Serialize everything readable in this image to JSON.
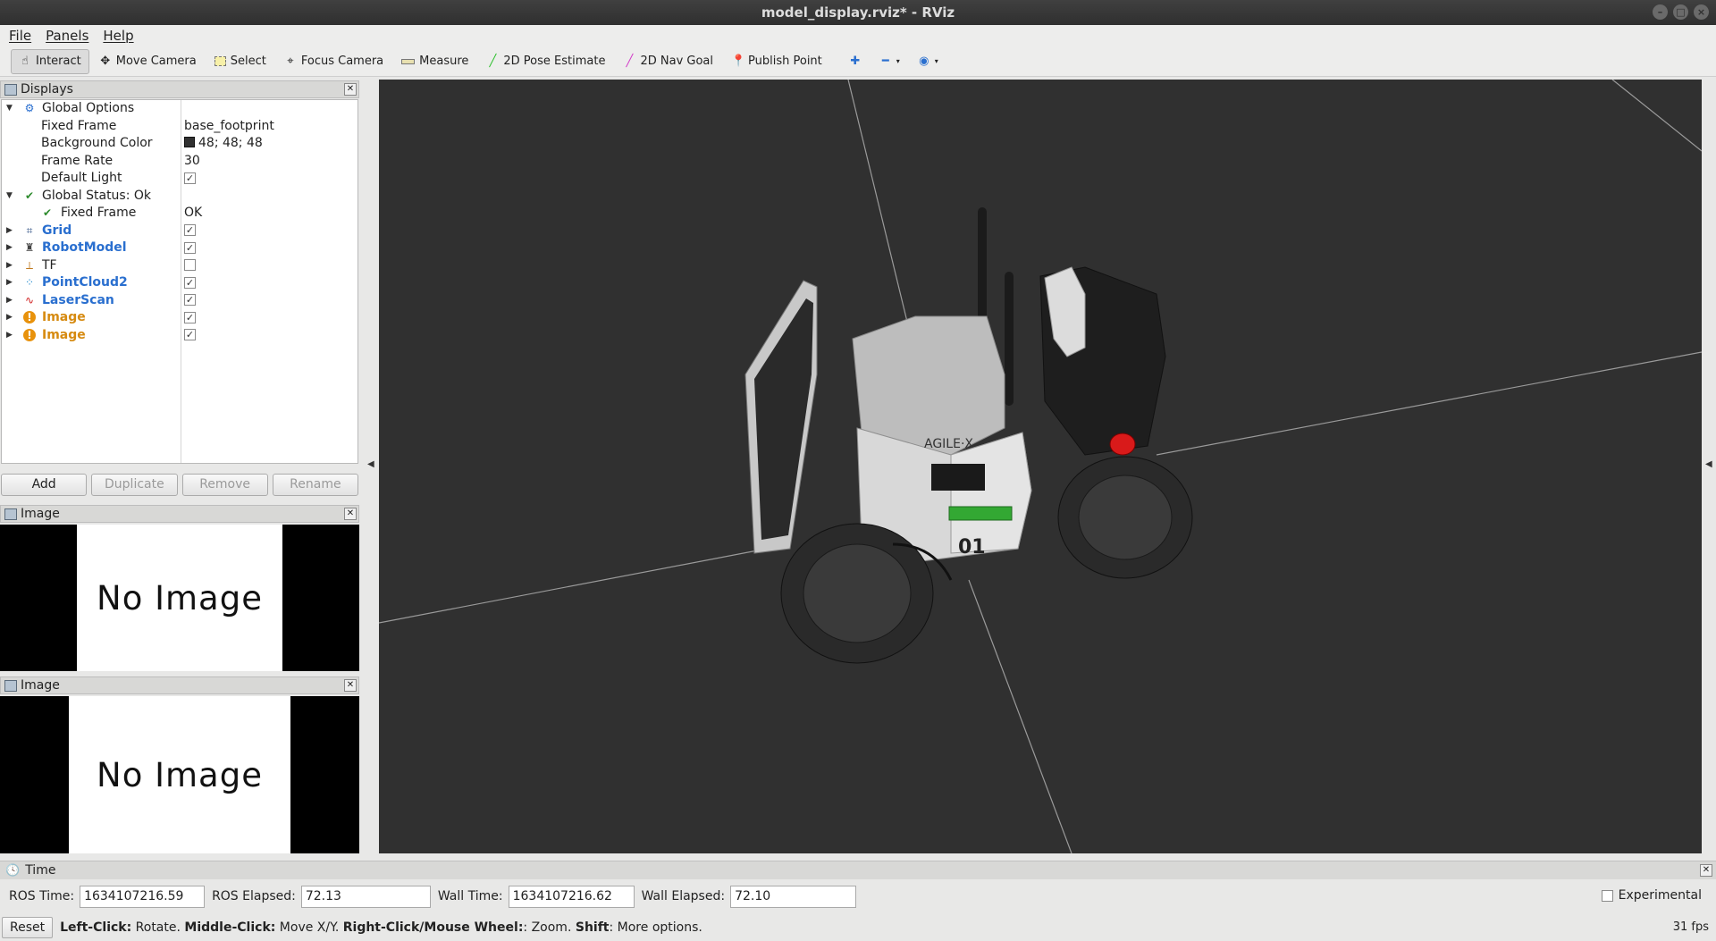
{
  "window": {
    "title": "model_display.rviz* - RViz"
  },
  "menu": [
    "File",
    "Panels",
    "Help"
  ],
  "toolbar": {
    "tools": [
      {
        "label": "Interact",
        "icon": "interact-icon",
        "active": true
      },
      {
        "label": "Move Camera",
        "icon": "move-camera-icon"
      },
      {
        "label": "Select",
        "icon": "select-icon"
      },
      {
        "label": "Focus Camera",
        "icon": "focus-camera-icon"
      },
      {
        "label": "Measure",
        "icon": "measure-icon"
      },
      {
        "label": "2D Pose Estimate",
        "icon": "pose-estimate-icon",
        "color": "#2ec02e"
      },
      {
        "label": "2D Nav Goal",
        "icon": "nav-goal-icon",
        "color": "#d23cc8"
      },
      {
        "label": "Publish Point",
        "icon": "publish-point-icon",
        "color": "#c0392b"
      }
    ]
  },
  "displays_panel": {
    "title": "Displays",
    "tree": [
      {
        "label": "Global Options",
        "value": "",
        "depth": 0,
        "expanded": true,
        "icon": "gear-icon"
      },
      {
        "label": "Fixed Frame",
        "value": "base_footprint",
        "depth": 1
      },
      {
        "label": "Background Color",
        "value": "48; 48; 48",
        "depth": 1,
        "swatch": "#303030"
      },
      {
        "label": "Frame Rate",
        "value": "30",
        "depth": 1
      },
      {
        "label": "Default Light",
        "value": "",
        "depth": 1,
        "checked": true
      },
      {
        "label": "Global Status: Ok",
        "value": "",
        "depth": 0,
        "expanded": true,
        "icon": "check-icon"
      },
      {
        "label": "Fixed Frame",
        "value": "OK",
        "depth": 1,
        "icon": "check-icon"
      },
      {
        "label": "Grid",
        "depth": 0,
        "checked": true,
        "style": "blue",
        "icon": "grid-icon"
      },
      {
        "label": "RobotModel",
        "depth": 0,
        "checked": true,
        "style": "blue",
        "icon": "robot-model-icon"
      },
      {
        "label": "TF",
        "depth": 0,
        "checked": false,
        "style": "plain",
        "icon": "tf-icon"
      },
      {
        "label": "PointCloud2",
        "depth": 0,
        "checked": true,
        "style": "blue",
        "icon": "pointcloud-icon"
      },
      {
        "label": "LaserScan",
        "depth": 0,
        "checked": true,
        "style": "blue",
        "icon": "laserscan-icon"
      },
      {
        "label": "Image",
        "depth": 0,
        "checked": true,
        "style": "orange",
        "icon": "warning-icon"
      },
      {
        "label": "Image",
        "depth": 0,
        "checked": true,
        "style": "orange",
        "icon": "warning-icon"
      }
    ],
    "buttons": [
      {
        "label": "Add",
        "enabled": true
      },
      {
        "label": "Duplicate",
        "enabled": false
      },
      {
        "label": "Remove",
        "enabled": false
      },
      {
        "label": "Rename",
        "enabled": false
      }
    ]
  },
  "image_panels": [
    {
      "title": "Image",
      "text": "No Image"
    },
    {
      "title": "Image",
      "text": "No Image"
    }
  ],
  "robot": {
    "logo": "AGILE·X",
    "number": "01"
  },
  "time_panel": {
    "title": "Time",
    "ros_time_label": "ROS Time:",
    "ros_time": "1634107216.59",
    "ros_elapsed_label": "ROS Elapsed:",
    "ros_elapsed": "72.13",
    "wall_time_label": "Wall Time:",
    "wall_time": "1634107216.62",
    "wall_elapsed_label": "Wall Elapsed:",
    "wall_elapsed": "72.10",
    "experimental_label": "Experimental"
  },
  "status_bar": {
    "reset_label": "Reset",
    "hints": [
      {
        "key": "Left-Click:",
        "desc": " Rotate. "
      },
      {
        "key": "Middle-Click:",
        "desc": " Move X/Y. "
      },
      {
        "key": "Right-Click/Mouse Wheel:",
        "desc": ": Zoom. "
      },
      {
        "key": "Shift",
        "desc": ": More options."
      }
    ],
    "fps": "31 fps"
  }
}
